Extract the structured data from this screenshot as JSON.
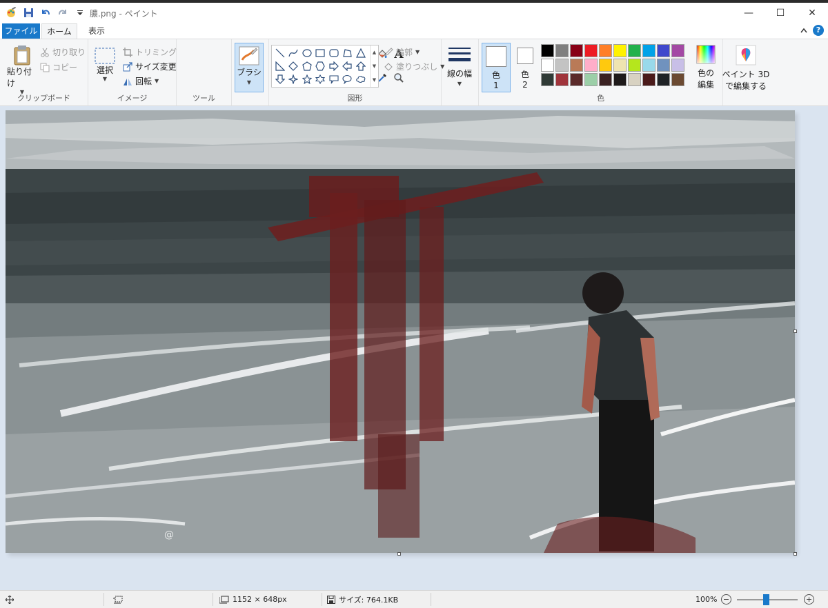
{
  "window": {
    "title": "膿.png - ペイント",
    "minimize": "—",
    "maximize": "☐",
    "close": "✕"
  },
  "tabs": {
    "file": "ファイル",
    "home": "ホーム",
    "view": "表示"
  },
  "ribbon": {
    "clipboard": {
      "label": "クリップボード",
      "paste": "貼り付け",
      "cut": "切り取り",
      "copy": "コピー"
    },
    "image": {
      "label": "イメージ",
      "select": "選択",
      "crop": "トリミング",
      "resize": "サイズ変更",
      "rotate": "回転"
    },
    "tools": {
      "label": "ツール",
      "text_glyph": "A"
    },
    "brush": {
      "label": "ブラシ"
    },
    "shapes": {
      "label": "図形",
      "outline": "輪郭",
      "fill": "塗りつぶし"
    },
    "size": {
      "label": "線の幅"
    },
    "colors": {
      "label": "色",
      "color1": "色\n1",
      "color1_a": "色",
      "color1_b": "1",
      "color2_a": "色",
      "color2_b": "2",
      "edit_a": "色の",
      "edit_b": "編集",
      "paint3d_a": "ペイント 3D",
      "paint3d_b": "で編集する",
      "palette": [
        "#000000",
        "#7f7f7f",
        "#880015",
        "#ed1c24",
        "#ff7f27",
        "#fff200",
        "#22b14c",
        "#00a2e8",
        "#3f48cc",
        "#a349a4",
        "#ffffff",
        "#c3c3c3",
        "#b97a57",
        "#ffaec9",
        "#ffc90e",
        "#efe4b0",
        "#b5e61d",
        "#99d9ea",
        "#7092be",
        "#c8bfe7",
        "#2f3a36",
        "#a0343b",
        "#5a2a2a",
        "#9ccfa8",
        "#3a2222",
        "#1e1a1a",
        "#d8d2c2",
        "#4a1a1a",
        "#1f2326",
        "#6b4a32"
      ]
    }
  },
  "status": {
    "dimensions": "1152 × 648px",
    "file_size": "サイズ: 764.1KB",
    "zoom": "100%",
    "zoom_out": "−",
    "zoom_in": "+"
  }
}
